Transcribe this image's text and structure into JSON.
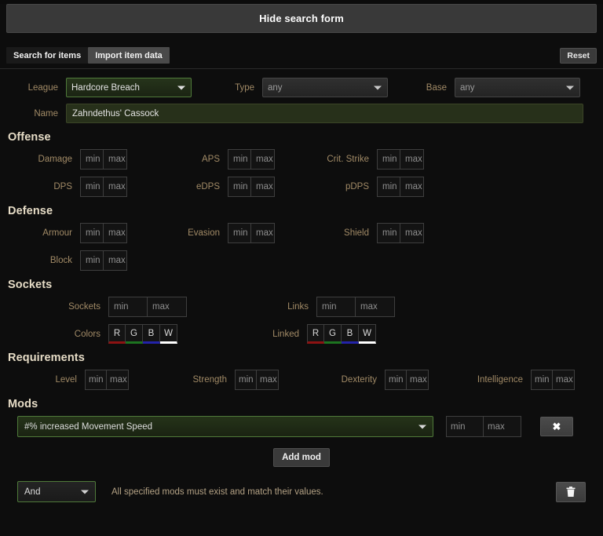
{
  "header": {
    "toggle_label": "Hide search form"
  },
  "tabs": [
    {
      "label": "Search for items",
      "active": true
    },
    {
      "label": "Import item data",
      "active": false
    }
  ],
  "reset": {
    "label": "Reset"
  },
  "top": {
    "league": {
      "label": "League",
      "value": "Hardcore Breach"
    },
    "type": {
      "label": "Type",
      "value": "any"
    },
    "base": {
      "label": "Base",
      "value": "any"
    },
    "name": {
      "label": "Name",
      "value": "Zahndethus' Cassock"
    }
  },
  "placeholders": {
    "min": "min",
    "max": "max"
  },
  "sections": {
    "offense": {
      "title": "Offense",
      "fields": [
        {
          "label": "Damage"
        },
        {
          "label": "APS"
        },
        {
          "label": "Crit. Strike"
        },
        {
          "label": "DPS"
        },
        {
          "label": "eDPS"
        },
        {
          "label": "pDPS"
        }
      ]
    },
    "defense": {
      "title": "Defense",
      "fields": [
        {
          "label": "Armour"
        },
        {
          "label": "Evasion"
        },
        {
          "label": "Shield"
        },
        {
          "label": "Block"
        }
      ]
    },
    "sockets": {
      "title": "Sockets",
      "sockets_label": "Sockets",
      "links_label": "Links",
      "colors_label": "Colors",
      "linked_label": "Linked",
      "color_boxes": [
        "R",
        "G",
        "B",
        "W"
      ]
    },
    "requirements": {
      "title": "Requirements",
      "fields": [
        {
          "label": "Level"
        },
        {
          "label": "Strength"
        },
        {
          "label": "Dexterity"
        },
        {
          "label": "Intelligence"
        }
      ]
    },
    "mods": {
      "title": "Mods",
      "mod_value": "#% increased Movement Speed",
      "remove_label": "✖",
      "add_label": "Add mod",
      "match_mode": "And",
      "match_note": "All specified mods must exist and match their values."
    }
  },
  "colors": {
    "accent_green": "#4f7a3a",
    "label_tan": "#a18a66",
    "heading_cream": "#e6dcc6",
    "panel_dark": "#0d0d0d",
    "socket_r": "#8d1212",
    "socket_g": "#1d7420",
    "socket_b": "#2323a8",
    "socket_w": "#ffffff"
  }
}
